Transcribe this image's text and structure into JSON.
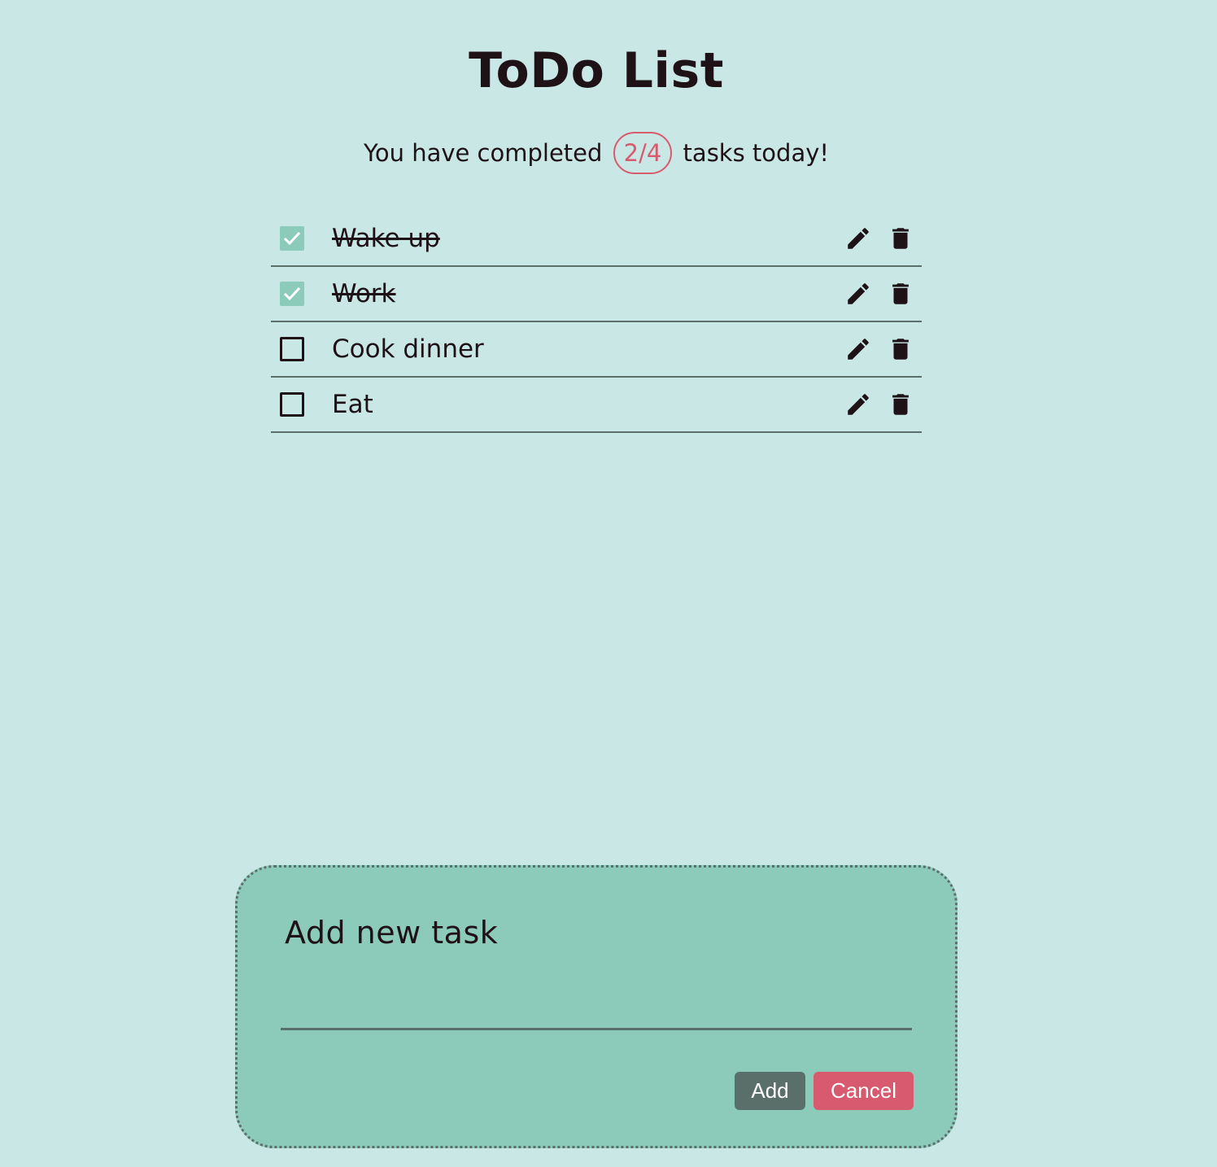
{
  "header": {
    "title": "ToDo List",
    "summary_prefix": "You have completed",
    "completed_count": "2/4",
    "summary_suffix": "tasks today!"
  },
  "tasks": [
    {
      "label": "Wake up",
      "completed": true
    },
    {
      "label": "Work",
      "completed": true
    },
    {
      "label": "Cook dinner",
      "completed": false
    },
    {
      "label": "Eat",
      "completed": false
    }
  ],
  "icons": {
    "edit": "pencil-icon",
    "delete": "trash-icon",
    "check": "check-icon"
  },
  "add_form": {
    "title": "Add new task",
    "input_value": "",
    "add_label": "Add",
    "cancel_label": "Cancel"
  },
  "colors": {
    "background": "#c8e7e5",
    "panel": "#8ccab9",
    "accent": "#d85a6e",
    "dark": "#5b6f6a",
    "text": "#1f1216"
  }
}
